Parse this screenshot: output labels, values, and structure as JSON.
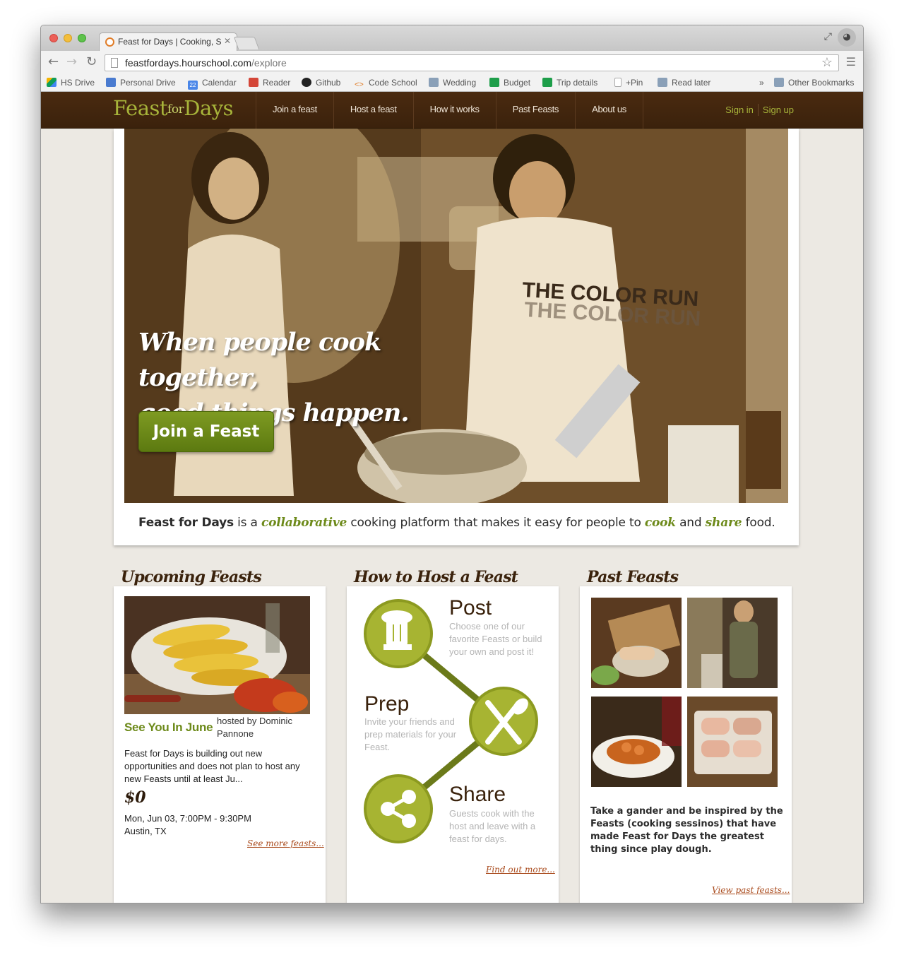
{
  "browser": {
    "tab_title": "Feast for Days | Cooking, S",
    "url_host": "feastfordays.hourschool.com",
    "url_path": "/explore",
    "bookmarks": [
      {
        "label": "HS Drive",
        "icon": "google-drive-icon",
        "color": "#3f8ae0"
      },
      {
        "label": "Personal Drive",
        "icon": "document-icon",
        "color": "#4a7bd0"
      },
      {
        "label": "Calendar",
        "icon": "calendar-icon",
        "color": "#4a86e8"
      },
      {
        "label": "Reader",
        "icon": "reader-icon",
        "color": "#d44638"
      },
      {
        "label": "Github",
        "icon": "github-icon",
        "color": "#222222"
      },
      {
        "label": "Code School",
        "icon": "code-icon",
        "color": "#e07c27"
      },
      {
        "label": "Wedding",
        "icon": "folder-icon",
        "color": "#8aa0b8"
      },
      {
        "label": "Budget",
        "icon": "spreadsheet-icon",
        "color": "#1e9e4a"
      },
      {
        "label": "Trip details",
        "icon": "spreadsheet-icon",
        "color": "#1e9e4a"
      },
      {
        "label": "+Pin",
        "icon": "page-icon",
        "color": "#cccccc"
      },
      {
        "label": "Read later",
        "icon": "folder-icon",
        "color": "#8aa0b8"
      }
    ],
    "bookmarks_overflow": "»",
    "other_bookmarks": "Other Bookmarks"
  },
  "nav": {
    "logo_feast": "Feast",
    "logo_for": "for",
    "logo_days": "Days",
    "items": [
      "Join a feast",
      "Host a feast",
      "How it works",
      "Past Feasts",
      "About us"
    ],
    "sign_in": "Sign in",
    "sign_up": "Sign up"
  },
  "hero": {
    "tagline_line1": "When people cook together,",
    "tagline_line2": "good things happen.",
    "cta": "Join a Feast",
    "sub_brand": "Feast for Days",
    "sub_1": " is a ",
    "sub_collab": "collaborative",
    "sub_2": " cooking platform that makes it easy for people to ",
    "sub_cook": "cook",
    "sub_3": " and ",
    "sub_share": "share",
    "sub_4": " food."
  },
  "upcoming": {
    "heading": "Upcoming Feasts",
    "feast_title": "See You In June",
    "hosted_by": "hosted by Dominic Pannone",
    "description": "Feast for Days is building out new opportunities and does not plan to host any new Feasts until at least Ju...",
    "price": "$0",
    "date": "Mon, Jun 03, 7:00PM - 9:30PM",
    "location": "Austin, TX",
    "more": "See more feasts..."
  },
  "howto": {
    "heading": "How to Host a Feast",
    "steps": [
      {
        "title": "Post",
        "desc": "Choose one of our favorite Feasts or build your own and post it!",
        "icon": "chef-hat-icon"
      },
      {
        "title": "Prep",
        "desc": "Invite your friends and prep materials for your Feast.",
        "icon": "fork-knife-icon"
      },
      {
        "title": "Share",
        "desc": "Guests cook with the host and leave with a feast for days.",
        "icon": "share-icon"
      }
    ],
    "more": "Find out more..."
  },
  "past": {
    "heading": "Past Feasts",
    "text": "Take a gander and be inspired by the Feasts (cooking sessinos) that have made Feast for Days the greatest thing since play dough.",
    "more": "View past feasts..."
  },
  "colors": {
    "nav_bg": "#3b220c",
    "accent_green": "#6d8a1a",
    "icon_green": "#a7b432",
    "link_orange": "#a94a1c"
  }
}
